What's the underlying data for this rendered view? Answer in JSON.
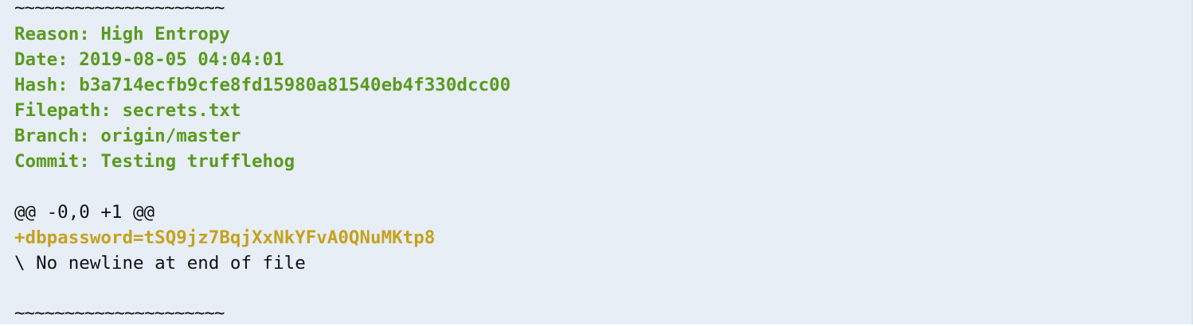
{
  "output": {
    "separator_top": "~~~~~~~~~~~~~~~~~~~~~",
    "reason": "Reason: High Entropy",
    "date": "Date: 2019-08-05 04:04:01",
    "hash": "Hash: b3a714ecfb9cfe8fd15980a81540eb4f330dcc00",
    "filepath": "Filepath: secrets.txt",
    "branch": "Branch: origin/master",
    "commit": "Commit: Testing trufflehog",
    "diff_header": "@@ -0,0 +1 @@",
    "diff_added": "+dbpassword=tSQ9jz7BqjXxNkYFvA0QNuMKtp8",
    "no_newline": "\\ No newline at end of file",
    "separator_bottom": "~~~~~~~~~~~~~~~~~~~~~"
  },
  "colors": {
    "background": "#e8eef6",
    "metadata_text": "#5a9a1f",
    "added_line": "#c4a21e",
    "plain_text": "#111111"
  }
}
